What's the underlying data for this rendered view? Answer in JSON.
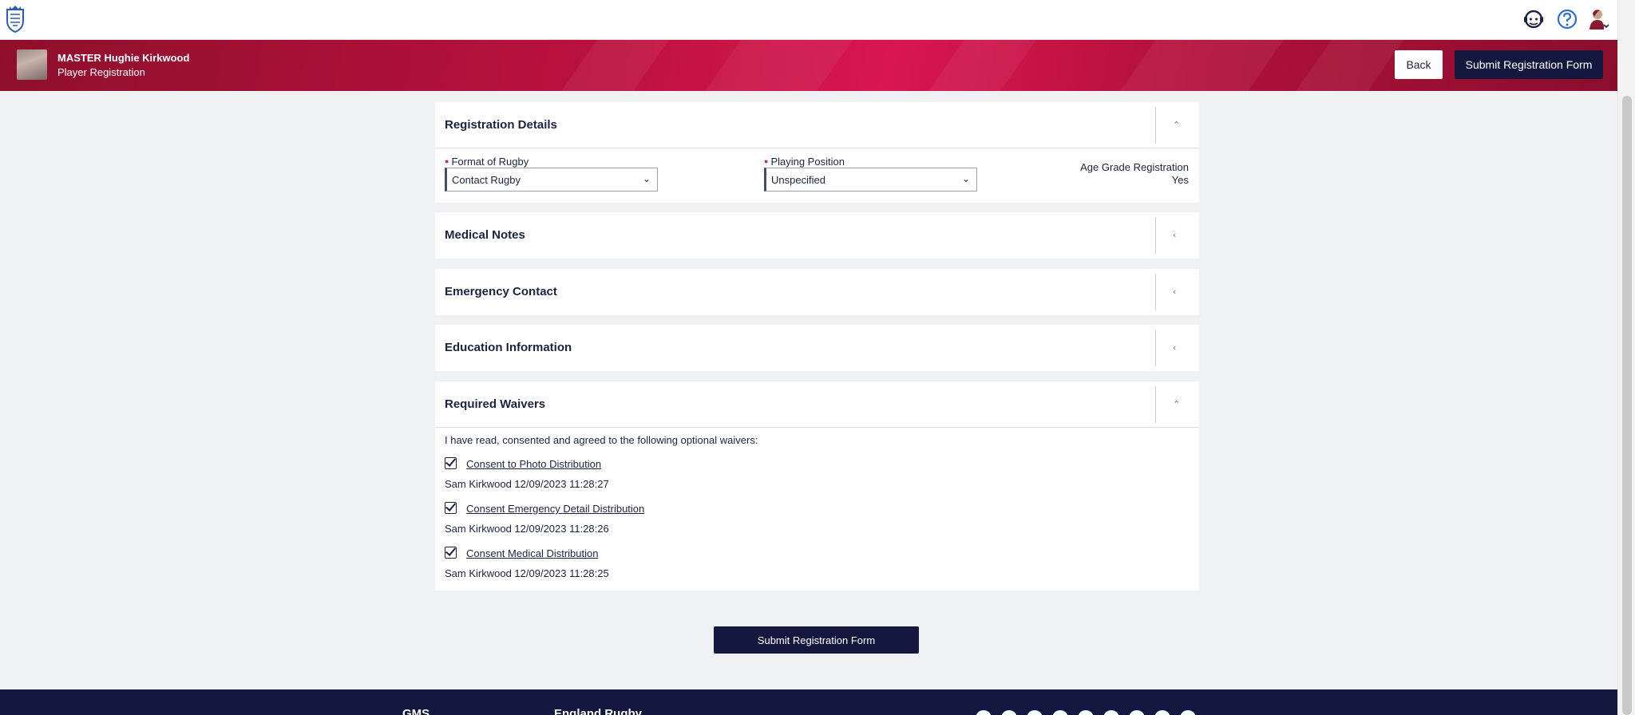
{
  "header": {
    "logo_icon": "shield-crest-logo",
    "icons": [
      "support-agent-icon",
      "help-icon",
      "user-profile-icon"
    ]
  },
  "banner": {
    "player_name": "MASTER Hughie Kirkwood",
    "subtitle": "Player Registration",
    "back_label": "Back",
    "submit_label": "Submit Registration Form"
  },
  "registration_details": {
    "title": "Registration Details",
    "format_label": "Format of Rugby",
    "format_value": "Contact Rugby",
    "position_label": "Playing Position",
    "position_value": "Unspecified",
    "age_grade_label": "Age Grade Registration",
    "age_grade_value": "Yes"
  },
  "sections": {
    "medical_notes": "Medical Notes",
    "emergency_contact": "Emergency Contact",
    "education_information": "Education Information",
    "required_waivers": "Required Waivers"
  },
  "waivers": {
    "intro": "I have read, consented and agreed to the following optional waivers:",
    "items": [
      {
        "label": "Consent to Photo Distribution",
        "meta": "Sam Kirkwood 12/09/2023 11:28:27",
        "checked": true
      },
      {
        "label": "Consent Emergency Detail Distribution",
        "meta": "Sam Kirkwood 12/09/2023 11:28:26",
        "checked": true
      },
      {
        "label": "Consent Medical Distribution",
        "meta": "Sam Kirkwood 12/09/2023 11:28:25",
        "checked": true
      }
    ]
  },
  "bottom": {
    "submit_label": "Submit Registration Form"
  },
  "footer": {
    "col1": "GMS",
    "col2": "England Rugby"
  },
  "colors": {
    "banner": "#b8113d",
    "navy": "#14183f",
    "background": "#f0f1f4"
  }
}
